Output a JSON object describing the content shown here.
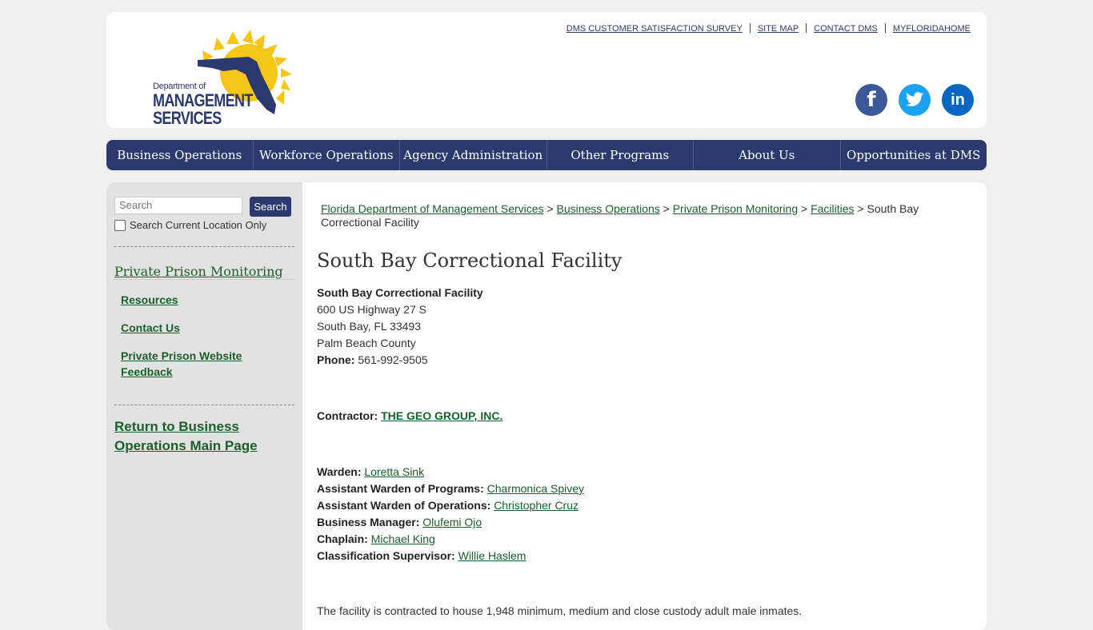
{
  "header": {
    "logo": {
      "line1": "Department of",
      "line2": "MANAGEMENT",
      "line3": "SERVICES"
    },
    "top_links": [
      "DMS CUSTOMER SATISFACTION SURVEY",
      "SITE MAP",
      "CONTACT DMS",
      "MYFLORIDAHOME"
    ],
    "social": [
      "facebook-icon",
      "twitter-icon",
      "linkedin-icon"
    ],
    "colors": {
      "brand_navy": "#2b3a6e",
      "sun_yellow": "#f5c518",
      "link_green": "#1a5e2a"
    }
  },
  "nav": [
    "Business Operations",
    "Workforce Operations",
    "Agency Administration",
    "Other Programs",
    "About Us",
    "Opportunities at DMS"
  ],
  "sidebar": {
    "search_placeholder": "Search",
    "search_button": "Search",
    "search_location_label": "Search Current Location Only",
    "section_title": "Private Prison Monitoring",
    "links": [
      "Resources",
      "Contact Us",
      "Private Prison Website Feedback"
    ],
    "return_link": "Return to Business Operations Main Page"
  },
  "breadcrumb": {
    "items": [
      "Florida Department of Management Services",
      "Business Operations",
      "Private Prison Monitoring",
      "Facilities"
    ],
    "separator": ">",
    "current": "South Bay Correctional Facility"
  },
  "page": {
    "title": "South Bay Correctional Facility",
    "facility_name": "South Bay Correctional Facility",
    "address1": "600 US Highway 27 S",
    "address2": "South Bay, FL 33493",
    "county": "Palm Beach County",
    "phone_label": "Phone:",
    "phone": "561-992-9505",
    "contractor_label": "Contractor:",
    "contractor": "THE GEO GROUP, INC.",
    "staff": [
      {
        "role": "Warden:",
        "name": "Loretta Sink"
      },
      {
        "role": "Assistant Warden of Programs:",
        "name": "Charmonica Spivey"
      },
      {
        "role": "Assistant Warden of Operations:",
        "name": "Christopher Cruz"
      },
      {
        "role": "Business Manager:",
        "name": "Olufemi Ojo"
      },
      {
        "role": "Chaplain:",
        "name": "Michael King"
      },
      {
        "role": "Classification Supervisor:",
        "name": "Willie Haslem"
      }
    ],
    "description": "The facility is contracted to house 1,948 minimum, medium and close custody adult male inmates."
  }
}
